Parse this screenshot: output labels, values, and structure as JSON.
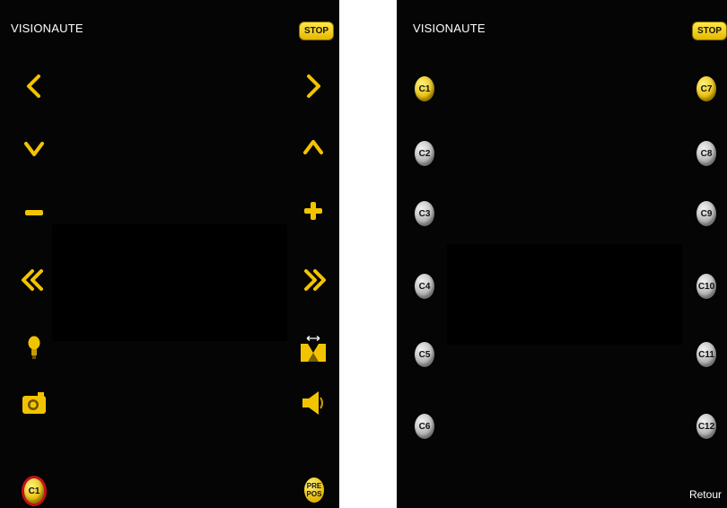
{
  "left_screen": {
    "title": "VISIONAUTE",
    "stop_label": "STOP",
    "left_icons": [
      "chevron-left-icon",
      "chevron-down-icon",
      "minus-icon",
      "double-chevron-left-icon",
      "lightbulb-icon",
      "camera-icon"
    ],
    "right_icons": [
      "chevron-right-icon",
      "chevron-up-icon",
      "plus-icon",
      "double-chevron-right-icon",
      "width-adjust-icon",
      "speaker-icon"
    ],
    "bottom_left_button": "C1",
    "bottom_right_button": {
      "line1": "PRE",
      "line2": "POS"
    }
  },
  "right_screen": {
    "title": "VISIONAUTE",
    "stop_label": "STOP",
    "left_buttons": [
      "C1",
      "C2",
      "C3",
      "C4",
      "C5",
      "C6"
    ],
    "right_buttons": [
      "C7",
      "C8",
      "C9",
      "C10",
      "C11",
      "C12"
    ],
    "active_buttons": [
      "C1",
      "C7"
    ],
    "back_label": "Retour"
  },
  "colors": {
    "accent": "#f2c400",
    "background": "#050505",
    "ring": "#c0121b"
  }
}
